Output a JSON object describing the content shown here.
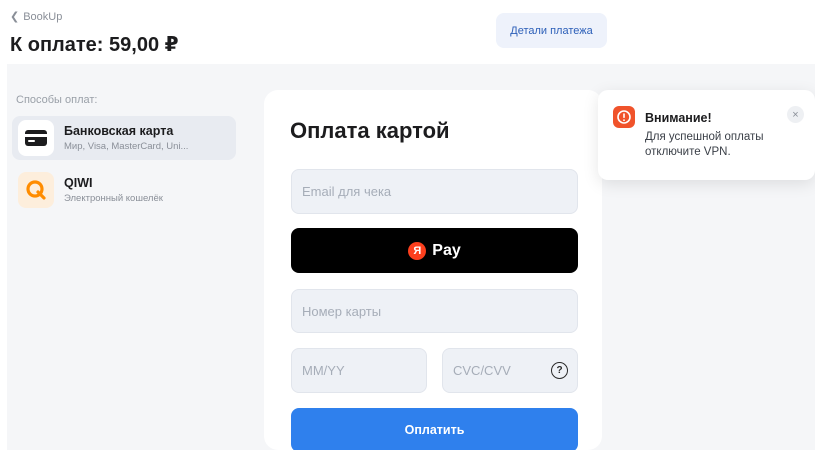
{
  "header": {
    "back_label": "BookUp",
    "amount_title": "К оплате: 59,00 ₽",
    "details_button": "Детали платежа"
  },
  "sidebar": {
    "title": "Способы оплат:",
    "methods": [
      {
        "name": "Банковская карта",
        "subtitle": "Мир, Visa, MasterCard, Uni...",
        "icon": "credit-card-icon",
        "active": true
      },
      {
        "name": "QIWI",
        "subtitle": "Электронный кошелёк",
        "icon": "qiwi-logo-icon",
        "active": false
      }
    ]
  },
  "payment_form": {
    "title": "Оплата картой",
    "email_placeholder": "Email для чека",
    "yandex_pay_logo": "Я",
    "yandex_pay_label": "Pay",
    "card_number_placeholder": "Номер карты",
    "expiry_placeholder": "MM/YY",
    "cvc_placeholder": "CVC/CVV",
    "help_symbol": "?",
    "submit_label": "Оплатить"
  },
  "toast": {
    "title": "Внимание!",
    "message": "Для успешной оплаты отключите VPN.",
    "close_symbol": "×",
    "icon": "alert-icon"
  },
  "colors": {
    "primary": "#2f80ed",
    "alert": "#f0532b",
    "yandex_red": "#fc3f1d",
    "qiwi_orange": "#ff8c00"
  }
}
